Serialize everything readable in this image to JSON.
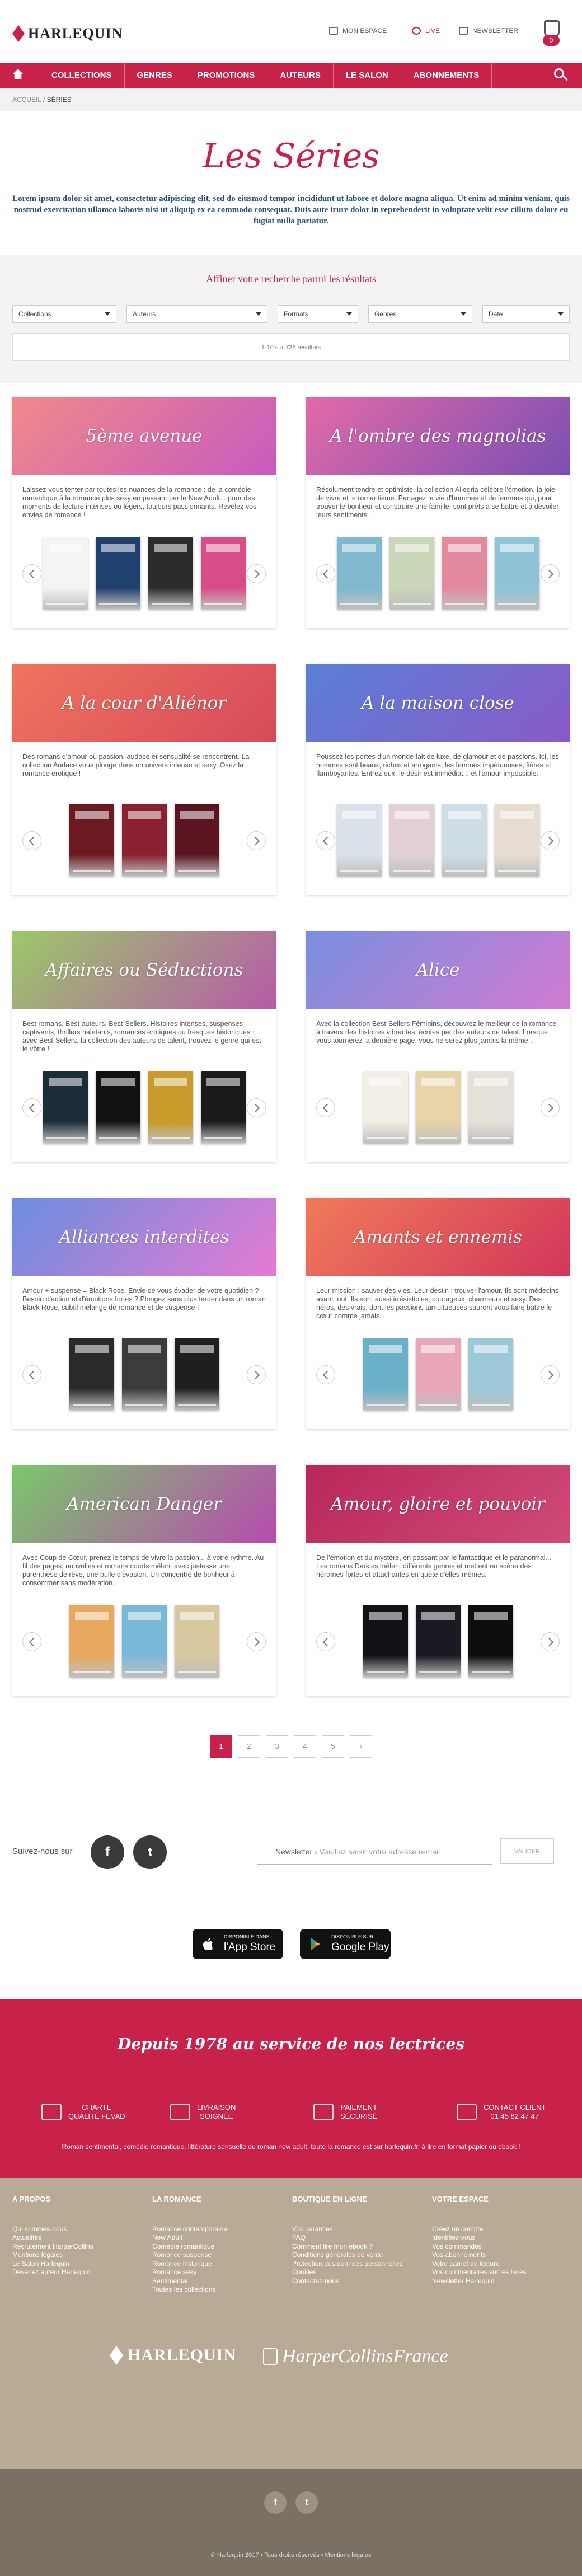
{
  "header": {
    "logo_text": "HARLEQUIN",
    "util": [
      {
        "label": "MON ESPACE",
        "icon": "user-icon"
      },
      {
        "label": "LIVE",
        "icon": "live-icon"
      },
      {
        "label": "NEWSLETTER",
        "icon": "mail-icon"
      }
    ],
    "cart_count": "0"
  },
  "nav": [
    "COLLECTIONS",
    "GENRES",
    "PROMOTIONS",
    "AUTEURS",
    "LE SALON",
    "ABONNEMENTS"
  ],
  "breadcrumb": {
    "home": "ACCUEIL",
    "sep": "/",
    "current": "SÉRIES"
  },
  "page": {
    "title": "Les Séries",
    "intro": "Lorem ipsum dolor sit amet, consectetur adipiscing elit, sed do eiusmod tempor incididunt ut labore et dolore magna aliqua. Ut enim ad minim veniam, quis nostrud exercitation ullamco laboris nisi ut aliquip ex ea commodo consequat. Duis aute irure dolor in reprehenderit in voluptate velit esse cillum dolore eu fugiat nulla pariatur."
  },
  "filters": {
    "title": "Affiner votre recherche parmi les résultats",
    "selects": [
      "Collections",
      "Auteurs",
      "Formats",
      "Genres",
      "Date"
    ],
    "results": "1-10 sur 735 résultats"
  },
  "series": [
    {
      "name": "5ème avenue",
      "desc": "Laissez-vous tenter par toutes les nuances de la romance : de la comédie romantique à la romance plus sexy en passant par le New Adult... pour des moments de lecture intenses ou légers, toujours passionnants. Révélez vos envies de romance !",
      "c1": "#f08a8a",
      "c2": "#c75abf",
      "covers": [
        "#f4f4f4",
        "#1f3f6e",
        "#2c2c2c",
        "#d94c8a"
      ]
    },
    {
      "name": "A l'ombre des magnolias",
      "desc": "Résolument tendre et optimiste, la collection Allegria célèbre l'émotion, la joie de vivre et le romantisme. Partagez la vie d'hommes et de femmes qui, pour trouver le bonheur et construire une famille, sont prêts à se battre et à dévoiler leurs sentiments.",
      "c1": "#e26aa8",
      "c2": "#7a4fb3",
      "covers": [
        "#7fb8cf",
        "#c9d6b8",
        "#e48aa0",
        "#8fc3d8"
      ]
    },
    {
      "name": "A la cour d'Aliénor",
      "desc": "Des romans d'amour où passion, audace et sensualité se rencontrent. La collection Audace vous plonge dans un univers intense et sexy. Osez la romance érotique !",
      "c1": "#f0745e",
      "c2": "#d64a5a",
      "covers": [
        "#6b1a22",
        "#8b2030",
        "#5a1520"
      ]
    },
    {
      "name": "A la maison close",
      "desc": "Poussez les portes d'un monde fait de luxe, de glamour et de passions. Ici, les hommes sont beaux, riches et arrogants; les femmes impétueuses, fières et flamboyantes. Entrez eux, le désir est immédiat... et l'amour impossible.",
      "c1": "#5a7fd6",
      "c2": "#8a5ac8",
      "covers": [
        "#d9e2ea",
        "#e2d0d6",
        "#cfdde6",
        "#e6dcd2"
      ]
    },
    {
      "name": "Affaires ou Séductions",
      "desc": "Best romans, Best auteurs, Best-Sellers. Histoires intenses, suspenses captivants, thrillers haletants, romances érotiques ou fresques historiques : avec Best-Sellers, la collection des auteurs de talent, trouvez le genre qui est le vôtre !",
      "c1": "#9bc86a",
      "c2": "#b65aa8",
      "covers": [
        "#1c2d3a",
        "#111111",
        "#c89b2a",
        "#1a1a1a"
      ]
    },
    {
      "name": "Alice",
      "desc": "Avec la collection Best-Sellers Féminins, découvrez le meilleur de la romance à travers des histoires vibrantes, écrites par des auteurs de talent. Lorsque vous tournerez la dernière page, vous ne serez plus jamais la même...",
      "c1": "#7a8fe0",
      "c2": "#d07ad0",
      "covers": [
        "#f2efe6",
        "#e7d3a8",
        "#e6e1d8"
      ]
    },
    {
      "name": "Alliances interdites",
      "desc": "Amour + suspense = Black Rose. Envie de vous évader de votre quotidien ? Besoin d'action et d'émotions fortes ? Plongez sans plus tarder dans un roman Black Rose, subtil mélange de romance et de suspense !",
      "c1": "#6a8ee0",
      "c2": "#e67ad2",
      "covers": [
        "#2a2a2a",
        "#3b3b3b",
        "#1f1f1f"
      ]
    },
    {
      "name": "Amants et ennemis",
      "desc": "Leur mission : sauver des vies. Leur destin : trouver l'amour. Ils sont médecins avant tout. Ils sont aussi irrésistibles, courageux, charmeurs et sexy. Des héros, des vrais, dont les passions tumultueuses sauront vous faire battre le cœur comme jamais.",
      "c1": "#f07a5a",
      "c2": "#d2365a",
      "covers": [
        "#6ab0c8",
        "#e8a6b8",
        "#9cc8d8"
      ]
    },
    {
      "name": "American Danger",
      "desc": "Avec Coup de Cœur, prenez le temps de vivre la passion... à votre rythme. Au fil des pages, nouvelles et romans courts mêlent avec justesse une parenthèse de rêve, une bulle d'évasion. Un concentré de bonheur à consommer sans modération.",
      "c1": "#7ac86a",
      "c2": "#b84ab0",
      "covers": [
        "#e8a860",
        "#7ab8d8",
        "#d8c8a0"
      ]
    },
    {
      "name": "Amour, gloire et pouvoir",
      "desc": "De l'émotion et du mystère, en passant par le fantastique et le paranormal... Les romans Darkiss mêlent différents genres et mettent en scène des héroïnes fortes et attachantes en quête d'elles-mêmes.",
      "c1": "#b8285a",
      "c2": "#d04a78",
      "covers": [
        "#121216",
        "#1a1a22",
        "#0d0d10"
      ]
    }
  ],
  "pagination": {
    "pages": [
      "1",
      "2",
      "3",
      "4",
      "5"
    ],
    "next": "›"
  },
  "social": {
    "label": "Suivez-nous sur",
    "newsletter_label": "Newsletter",
    "newsletter_placeholder": "Veuillez saisir votre adresse e-mail",
    "submit": "VALIDER"
  },
  "stores": [
    {
      "small": "Disponible dans",
      "name": "l'App Store",
      "icon": "apple-icon"
    },
    {
      "small": "DISPONIBLE SUR",
      "name": "Google Play",
      "icon": "google-play-icon"
    }
  ],
  "band": {
    "title": "Depuis 1978 au service de nos lectrices",
    "features": [
      {
        "label": "CHARTE\nQUALITÉ FEVAD",
        "icon": "check-icon"
      },
      {
        "label": "LIVRAISON\nSOIGNÉE",
        "icon": "truck-icon"
      },
      {
        "label": "PAIEMENT\nSÉCURISÉ",
        "icon": "card-icon"
      },
      {
        "label": "CONTACT CLIENT\n01 45 82 47 47",
        "icon": "phone-icon"
      }
    ],
    "text": "Roman sentimental, comédie romantique, littérature sensuelle ou roman new adult, toute la romance est sur harlequin.fr, à lire en format papier ou ebook !"
  },
  "footer": {
    "cols": [
      {
        "title": "A PROPOS",
        "links": [
          "Qui sommes-nous",
          "Actualités",
          "Recrutement HarperCollins",
          "Mentions légales",
          "Le Salon Harlequin",
          "Devenez auteur Harlequin"
        ]
      },
      {
        "title": "LA ROMANCE",
        "links": [
          "Romance contemporaine",
          "New Adult",
          "Comédie romantique",
          "Romance suspense",
          "Romance historique",
          "Romance sexy",
          "Sentimental",
          "Toutes les collections"
        ]
      },
      {
        "title": "BOUTIQUE EN LIGNE",
        "links": [
          "Vos garanties",
          "FAQ",
          "Comment lire mon ebook ?",
          "Conditions générales de vente",
          "Protection des données personnelles",
          "Cookies",
          "Contactez-nous"
        ]
      },
      {
        "title": "VOTRE ESPACE",
        "links": [
          "Créez un compte",
          "Identifiez-vous",
          "Vos commandes",
          "Vos abonnements",
          "Votre carnet de lecture",
          "Vos commentaires sur les livres",
          "Newsletter Harlequin"
        ]
      }
    ],
    "brand1": "HARLEQUIN",
    "brand2": "HarperCollinsFrance",
    "copyright": "© Harlequin 2017 • Tous droits réservés • Mentions légales"
  }
}
